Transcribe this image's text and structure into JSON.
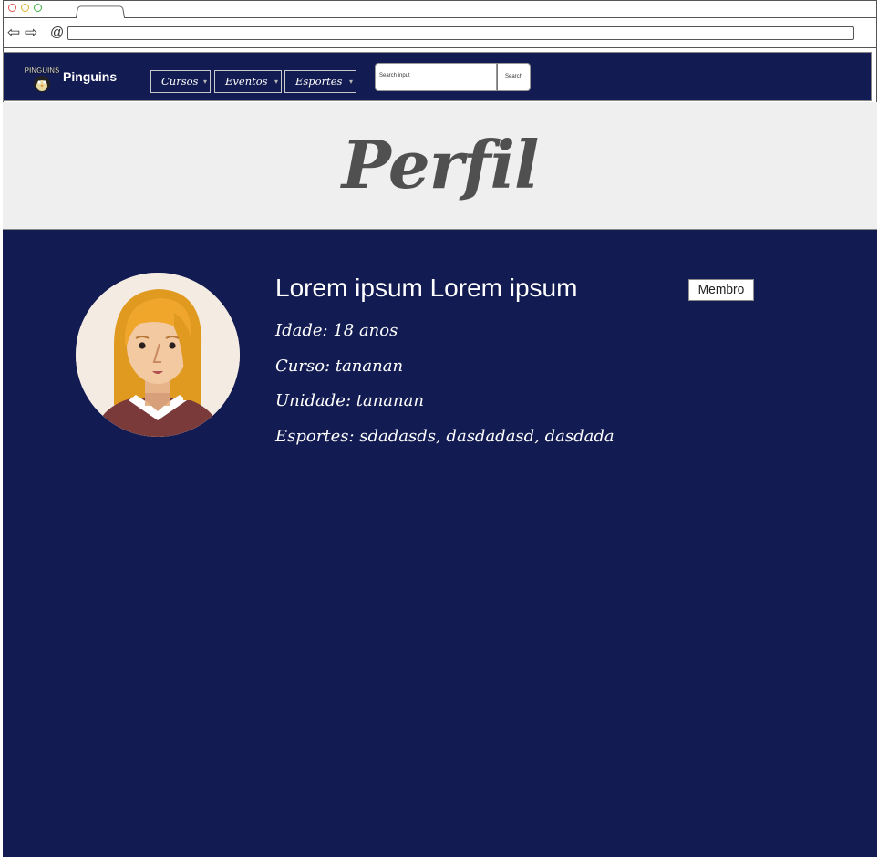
{
  "browser": {
    "dots": [
      "#e05050",
      "#e0b030",
      "#40b040"
    ],
    "icons": [
      "back-arrow-icon",
      "forward-arrow-icon",
      "reload-icon"
    ]
  },
  "nav": {
    "brand": "Pinguins",
    "logo_text": "PINGUINS",
    "menu": [
      {
        "label": "Cursos"
      },
      {
        "label": "Eventos"
      },
      {
        "label": "Esportes"
      }
    ],
    "search_placeholder": "Search input",
    "search_button": "Search"
  },
  "banner": {
    "title": "Perfil"
  },
  "profile": {
    "name": "Lorem ipsum Lorem ipsum",
    "badge": "Membro",
    "idade": "Idade: 18 anos",
    "curso": "Curso: tananan",
    "unidade": "Unidade: tananan",
    "esportes": "Esportes: sdadasds, dasdadasd, dasdada"
  },
  "colors": {
    "nav_bg": "#131c52",
    "banner_bg": "#efefef",
    "main_bg": "#131c52"
  }
}
